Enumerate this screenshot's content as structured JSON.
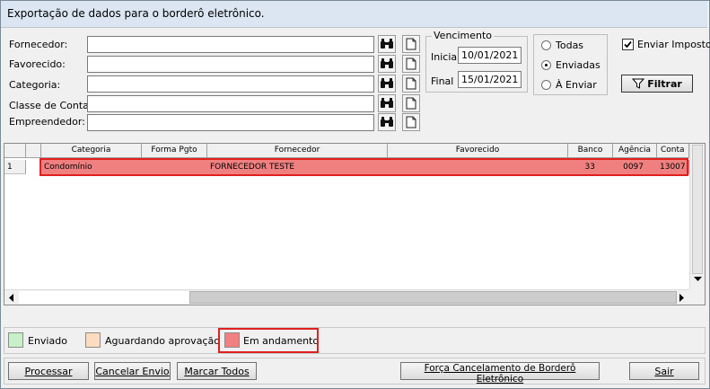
{
  "window": {
    "title": "Exportação de dados para o borderô eletrônico."
  },
  "filters": {
    "fornecedor": {
      "label": "Fornecedor:",
      "value": ""
    },
    "favorecido": {
      "label": "Favorecido:",
      "value": ""
    },
    "categoria": {
      "label": "Categoria:",
      "value": ""
    },
    "classe_conta": {
      "label": "Classe de Conta:",
      "value": ""
    },
    "empreendedor": {
      "label": "Empreendedor:",
      "value": ""
    }
  },
  "vencimento": {
    "title": "Vencimento",
    "inicial_label": "Inicial",
    "inicial_value": "10/01/2021",
    "final_label": "Final",
    "final_value": "15/01/2021"
  },
  "status_radio": {
    "options": [
      "Todas",
      "Enviadas",
      "À Enviar"
    ],
    "selected": "Enviadas"
  },
  "enviar_imposto": {
    "label": "Enviar Imposto",
    "checked": true
  },
  "filtrar_label": "Filtrar",
  "grid": {
    "columns": [
      "Categoria",
      "Forma Pgto",
      "Fornecedor",
      "Favorecido",
      "Banco",
      "Agência",
      "Conta"
    ],
    "rows": [
      {
        "num": "1",
        "categoria": "Condomínio",
        "forma_pgto": "",
        "fornecedor": "FORNECEDOR TESTE",
        "favorecido": "",
        "banco": "33",
        "agencia": "0097",
        "conta": "13007"
      }
    ],
    "row_color": "#f08080"
  },
  "legend": [
    {
      "label": "Enviado",
      "color": "#c8f0c8"
    },
    {
      "label": "Aguardando aprovação",
      "color": "#fcdcc0"
    },
    {
      "label": "Em andamento",
      "color": "#f28080"
    }
  ],
  "buttons": {
    "processar": "Processar",
    "cancelar_envio": "Cancelar Envio",
    "marcar_todos": "Marcar Todos",
    "forca_cancelamento": "Força Cancelamento de Borderô Eletrônico",
    "sair": "Sair"
  },
  "colors": {
    "highlight": "#e02020"
  }
}
